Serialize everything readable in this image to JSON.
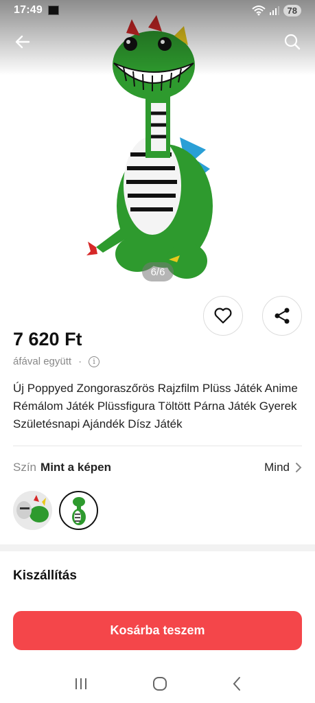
{
  "status_bar": {
    "time": "17:49",
    "battery": "78"
  },
  "gallery": {
    "pager": "6/6"
  },
  "product": {
    "price": "7 620 Ft",
    "vat_label": "áfával együtt",
    "vat_separator": "·",
    "title": "Új Poppyed Zongoraszőrös  Rajzfilm Plüss Játék Anime Rémálom Játék Plüssfigura Töltött Párna Játék Gyerek Születésnapi Ajándék Dísz Játék"
  },
  "variant": {
    "label": "Szín",
    "value": "Mint a képen",
    "all_label": "Mind"
  },
  "shipping": {
    "title": "Kiszállítás"
  },
  "cart": {
    "button_label": "Kosárba teszem"
  },
  "colors": {
    "accent": "#f4464a",
    "plush_green": "#2e9a2e"
  }
}
